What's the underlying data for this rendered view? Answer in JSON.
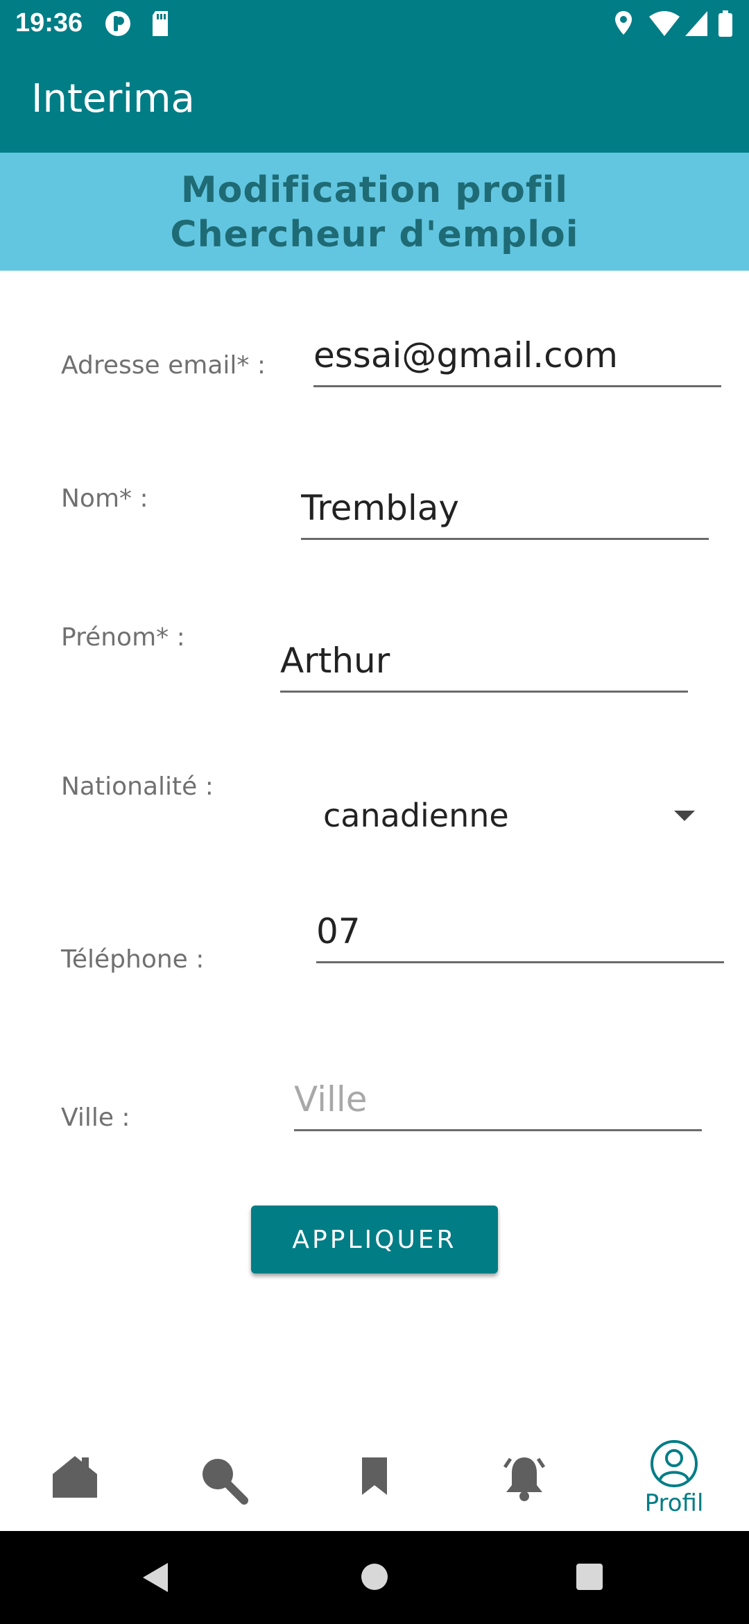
{
  "status_bar": {
    "time": "19:36",
    "icons": [
      "private-dns-icon",
      "sd-card-icon",
      "location-icon",
      "wifi-icon",
      "signal-icon",
      "battery-icon"
    ]
  },
  "app_bar": {
    "title": "Interima"
  },
  "banner": {
    "line1": "Modification profil",
    "line2": "Chercheur d'emploi"
  },
  "form": {
    "email": {
      "label": "Adresse email* :",
      "value": "essai@gmail.com"
    },
    "nom": {
      "label": "Nom* :",
      "value": "Tremblay"
    },
    "prenom": {
      "label": "Prénom* :",
      "value": "Arthur"
    },
    "nationalite": {
      "label": "Nationalité :",
      "value": "canadienne"
    },
    "telephone": {
      "label": "Téléphone :",
      "value": "07"
    },
    "ville": {
      "label": "Ville :",
      "value": "",
      "placeholder": "Ville"
    },
    "apply_label": "APPLIQUER"
  },
  "bottom_nav": {
    "items": [
      {
        "icon": "home-icon",
        "label": ""
      },
      {
        "icon": "search-icon",
        "label": ""
      },
      {
        "icon": "bookmark-icon",
        "label": ""
      },
      {
        "icon": "notifications-icon",
        "label": ""
      },
      {
        "icon": "profile-icon",
        "label": "Profil",
        "selected": true
      }
    ]
  },
  "colors": {
    "primary": "#017d86",
    "banner": "#63c6e0",
    "banner_text": "#1e6b75",
    "nav_inactive": "#5f5f5f"
  }
}
